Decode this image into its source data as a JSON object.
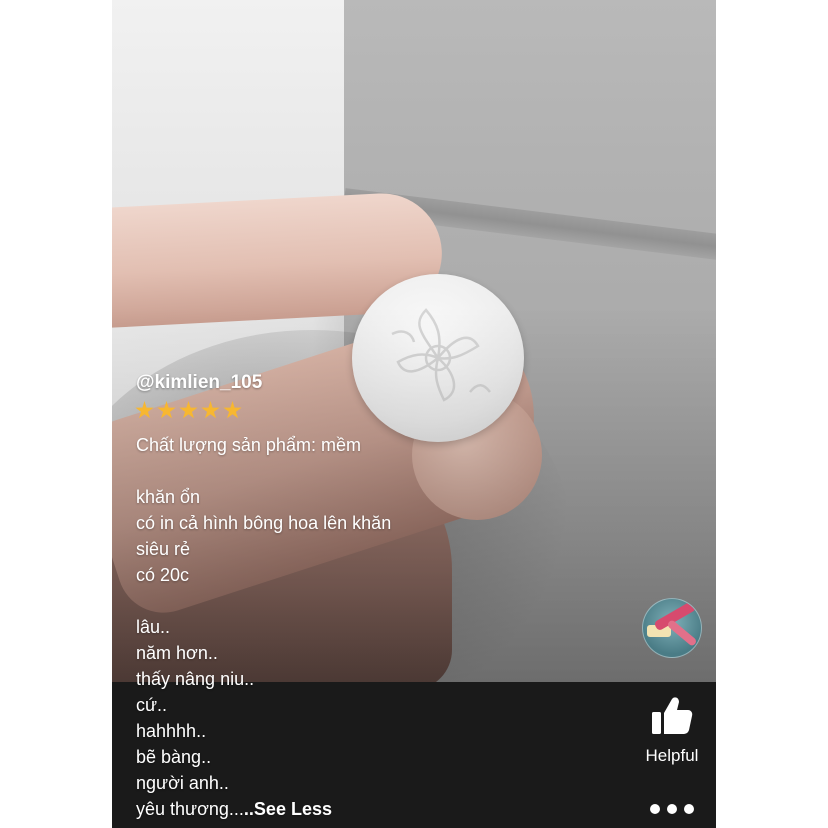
{
  "review": {
    "username": "@kimlien_105",
    "rating": 5,
    "rating_max": 5,
    "lines": [
      "Chất lượng sản phẩm: mềm",
      "",
      "khăn ổn",
      "có in cả hình bông hoa lên khăn",
      "siêu rẻ",
      "có 20c",
      "",
      "lâu..",
      "năm hơn..",
      "thấy nâng niu..",
      "cứ..",
      "hahhhh..",
      "bẽ bàng..",
      "người anh..",
      "yêu thương..."
    ],
    "see_less_label": "..See Less"
  },
  "actions": {
    "helpful_label": "Helpful",
    "helpful_icon": "thumbs-up-icon",
    "more_icon": "more-dots-icon"
  },
  "colors": {
    "star": "#f7b731",
    "text": "#ffffff",
    "bottom_bar": "#1a1a1a"
  }
}
